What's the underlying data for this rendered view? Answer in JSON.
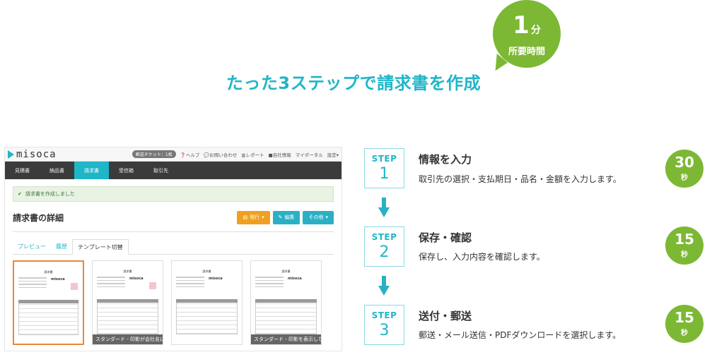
{
  "headline": "たった3ステップで請求書を作成",
  "bubble": {
    "number": "1",
    "unit": "分",
    "label": "所要時間"
  },
  "app": {
    "logo": "misoca",
    "ticket": "郵送チケット：1枚",
    "top_links": [
      "ヘルプ",
      "お問い合わせ",
      "レポート",
      "自社情報",
      "マイポータル",
      "設定"
    ],
    "nav": [
      "見積書",
      "納品書",
      "請求書",
      "受信箱",
      "取引先"
    ],
    "alert": "請求書を作成しました",
    "detail_title": "請求書の詳細",
    "buttons": {
      "issue": "発行",
      "edit": "編集",
      "other": "その他"
    },
    "tabs": [
      "プレビュー",
      "履歴",
      "テンプレート切替"
    ],
    "thumbnails": [
      {
        "title": "請求書",
        "logo": "misoca",
        "caption": ""
      },
      {
        "title": "請求書",
        "logo": "misoca",
        "caption": "スタンダード - 印影が会社名に"
      },
      {
        "title": "請求書",
        "logo": "misoca",
        "caption": ""
      },
      {
        "title": "請求書",
        "logo": "misoca",
        "caption": "スタンダード - 印影を表示しな"
      }
    ]
  },
  "steps": [
    {
      "word": "STEP",
      "number": "1",
      "title": "情報を入力",
      "desc": "取引先の選択・支払期日・品名・金額を入力します。",
      "time": "30",
      "time_unit": "秒"
    },
    {
      "word": "STEP",
      "number": "2",
      "title": "保存・確認",
      "desc": "保存し、入力内容を確認します。",
      "time": "15",
      "time_unit": "秒"
    },
    {
      "word": "STEP",
      "number": "3",
      "title": "送付・郵送",
      "desc": "郵送・メール送信・PDFダウンロードを選択します。",
      "time": "15",
      "time_unit": "秒"
    }
  ],
  "colors": {
    "accent": "#1fb6c8",
    "green": "#7cb834",
    "orange": "#f0a020",
    "nav": "#3b3b3b"
  }
}
